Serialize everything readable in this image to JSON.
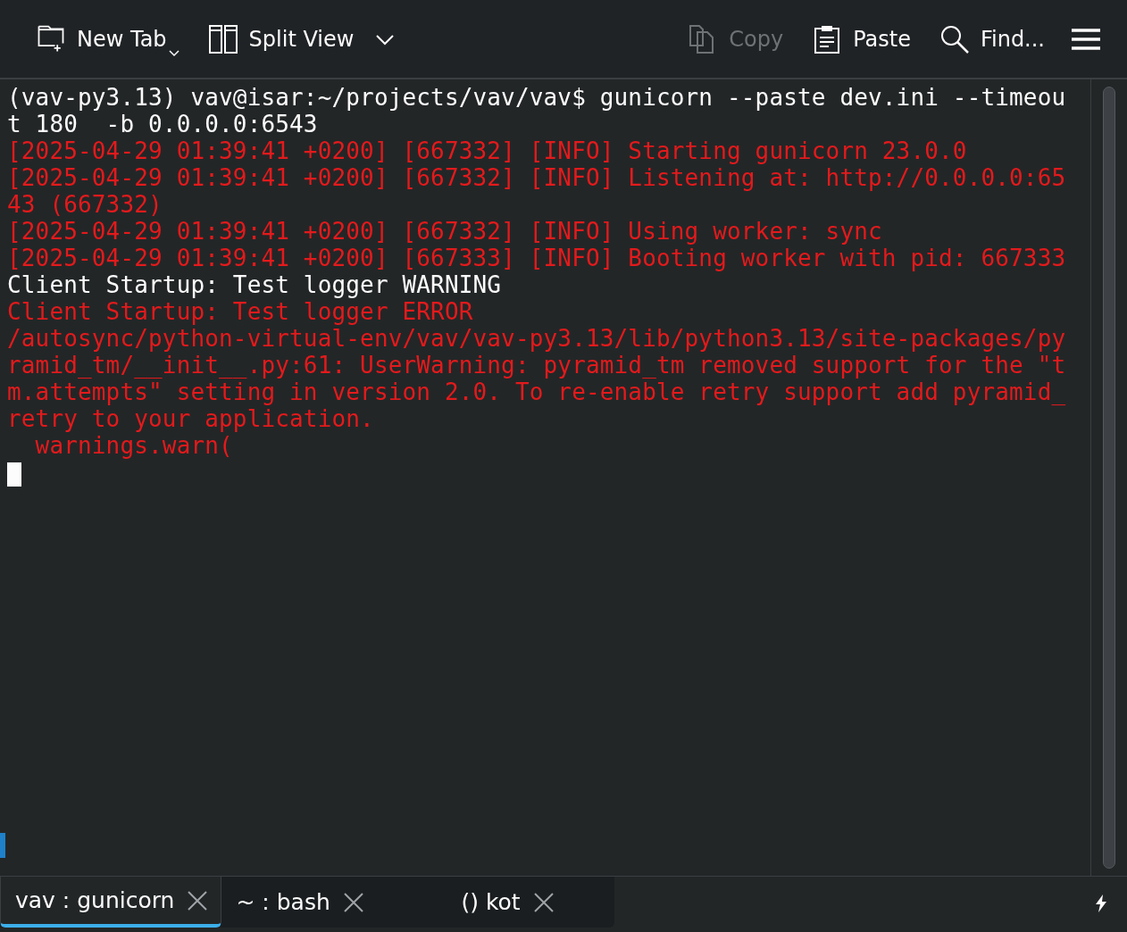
{
  "toolbar": {
    "left": [
      {
        "kind": "new-tab",
        "label": "New Tab",
        "disabled": false
      },
      {
        "kind": "split",
        "label": "Split View",
        "disabled": false
      }
    ],
    "right": [
      {
        "kind": "copy",
        "label": "Copy",
        "disabled": true
      },
      {
        "kind": "paste",
        "label": "Paste",
        "disabled": false
      },
      {
        "kind": "find",
        "label": "Find...",
        "disabled": false
      }
    ]
  },
  "terminal": {
    "lines": [
      {
        "text": "(vav-py3.13) vav@isar:~/projects/vav/vav$ gunicorn --paste dev.ini --timeou",
        "color": "#fcfcfc"
      },
      {
        "text": "t 180  -b 0.0.0.0:6543",
        "color": "#fcfcfc"
      },
      {
        "text": "[2025-04-29 01:39:41 +0200] [667332] [INFO] Starting gunicorn 23.0.0",
        "color": "#e31a1c"
      },
      {
        "text": "[2025-04-29 01:39:41 +0200] [667332] [INFO] Listening at: http://0.0.0.0:65",
        "color": "#e31a1c"
      },
      {
        "text": "43 (667332)",
        "color": "#e31a1c"
      },
      {
        "text": "[2025-04-29 01:39:41 +0200] [667332] [INFO] Using worker: sync",
        "color": "#e31a1c"
      },
      {
        "text": "[2025-04-29 01:39:41 +0200] [667333] [INFO] Booting worker with pid: 667333",
        "color": "#e31a1c"
      },
      {
        "text": "Client Startup: Test logger WARNING",
        "color": "#fcfcfc"
      },
      {
        "text": "Client Startup: Test logger ERROR",
        "color": "#e31a1c"
      },
      {
        "text": "/autosync/python-virtual-env/vav/vav-py3.13/lib/python3.13/site-packages/py",
        "color": "#e31a1c"
      },
      {
        "text": "ramid_tm/__init__.py:61: UserWarning: pyramid_tm removed support for the \"t",
        "color": "#e31a1c"
      },
      {
        "text": "m.attempts\" setting in version 2.0. To re-enable retry support add pyramid_",
        "color": "#e31a1c"
      },
      {
        "text": "retry to your application.",
        "color": "#e31a1c"
      },
      {
        "text": "  warnings.warn(",
        "color": "#e31a1c"
      }
    ]
  },
  "tabs": [
    {
      "label": "vav : gunicorn",
      "selected": true
    },
    {
      "label": "~ : bash",
      "selected": false
    },
    {
      "label": "() kot",
      "selected": false
    }
  ]
}
